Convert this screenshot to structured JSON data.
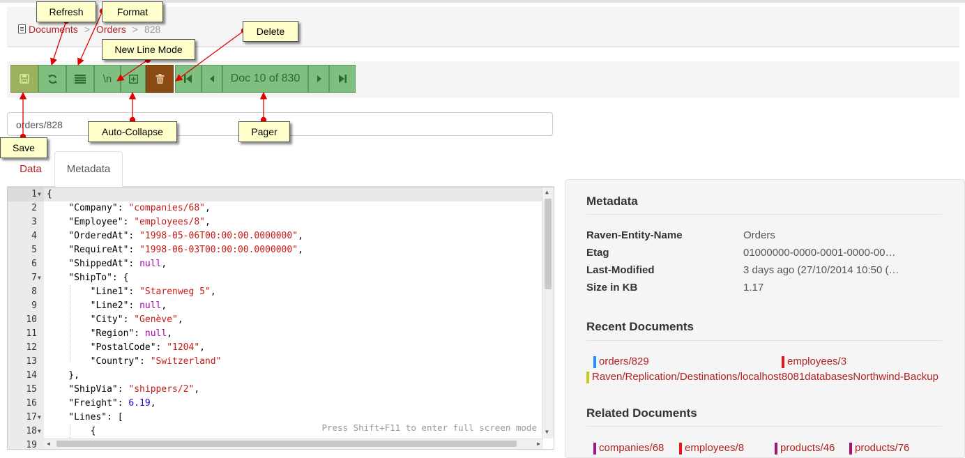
{
  "breadcrumb": {
    "documents": "Documents",
    "sep1": ">",
    "orders": "Orders",
    "sep2": ">",
    "current": "828"
  },
  "toolbar": {
    "save_icon": "floppy-disk-icon",
    "refresh_icon": "refresh-icon",
    "format_icon": "format-lines-icon",
    "newline_label": "\\n",
    "collapse_icon": "plus-square-icon",
    "delete_icon": "trash-icon",
    "pager_label": "Doc 10 of 830"
  },
  "doc_id": "orders/828",
  "tabs": {
    "data": "Data",
    "metadata": "Metadata"
  },
  "editor": {
    "hint": "Press Shift+F11 to enter full screen mode",
    "line_numbers": [
      "1",
      "2",
      "3",
      "4",
      "5",
      "6",
      "7",
      "8",
      "9",
      "10",
      "11",
      "12",
      "13",
      "14",
      "15",
      "16",
      "17",
      "18",
      "19"
    ]
  },
  "callouts": {
    "refresh": "Refresh",
    "format": "Format",
    "delete": "Delete",
    "new_line_mode": "New Line Mode",
    "auto_collapse": "Auto-Collapse",
    "pager": "Pager",
    "save": "Save"
  },
  "metadata_panel": {
    "title": "Metadata",
    "rows": [
      {
        "key": "Raven-Entity-Name",
        "value": "Orders"
      },
      {
        "key": "Etag",
        "value": "01000000-0000-0001-0000-00…"
      },
      {
        "key": "Last-Modified",
        "value": "3 days ago (27/10/2014 10:50 (…"
      },
      {
        "key": "Size in KB",
        "value": "1.17"
      }
    ],
    "recent_title": "Recent Documents",
    "recent": [
      {
        "label": "orders/829",
        "color": "#1e90ff"
      },
      {
        "label": "employees/3",
        "color": "#e8141e"
      },
      {
        "label": "Raven/Replication/Destinations/localhost8081databasesNorthwind-Backup",
        "color": "#c8c81e"
      }
    ],
    "related_title": "Related Documents",
    "related": [
      {
        "label": "companies/68",
        "color": "#a0148c"
      },
      {
        "label": "employees/8",
        "color": "#e8141e"
      },
      {
        "label": "products/46",
        "color": "#a0146e"
      },
      {
        "label": "products/76",
        "color": "#a0146e"
      }
    ]
  },
  "colors": {
    "accent": "#b22222",
    "button": "#7fbf7f",
    "delete": "#8a4a14",
    "callout": "#ffffcc"
  }
}
